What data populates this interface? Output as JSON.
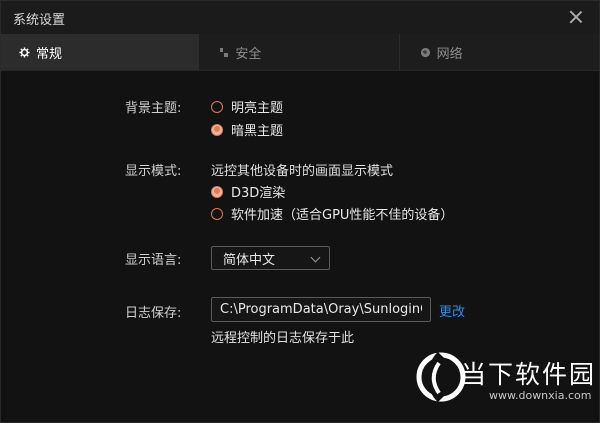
{
  "window": {
    "title": "系统设置"
  },
  "tabs": [
    {
      "label": "常规",
      "icon": "gear-icon",
      "active": true
    },
    {
      "label": "安全",
      "icon": "shield-icon",
      "active": false
    },
    {
      "label": "网络",
      "icon": "globe-icon",
      "active": false
    }
  ],
  "theme": {
    "label": "背景主题:",
    "options": [
      {
        "label": "明亮主题",
        "checked": false
      },
      {
        "label": "暗黑主题",
        "checked": true
      }
    ]
  },
  "display_mode": {
    "label": "显示模式:",
    "description": "远控其他设备时的画面显示模式",
    "options": [
      {
        "label": "D3D渲染",
        "checked": true
      },
      {
        "label": "软件加速（适合GPU性能不佳的设备）",
        "checked": false
      }
    ]
  },
  "language": {
    "label": "显示语言:",
    "selected": "简体中文"
  },
  "log": {
    "label": "日志保存:",
    "path": "C:\\ProgramData\\Oray\\SunloginClient\\log",
    "change_label": "更改",
    "description": "远程控制的日志保存于此"
  },
  "watermark": {
    "title": "当下软件园",
    "url": "www.downxia.com"
  },
  "colors": {
    "accent": "#e07a52",
    "link": "#2e8fe6",
    "background": "#121212"
  }
}
